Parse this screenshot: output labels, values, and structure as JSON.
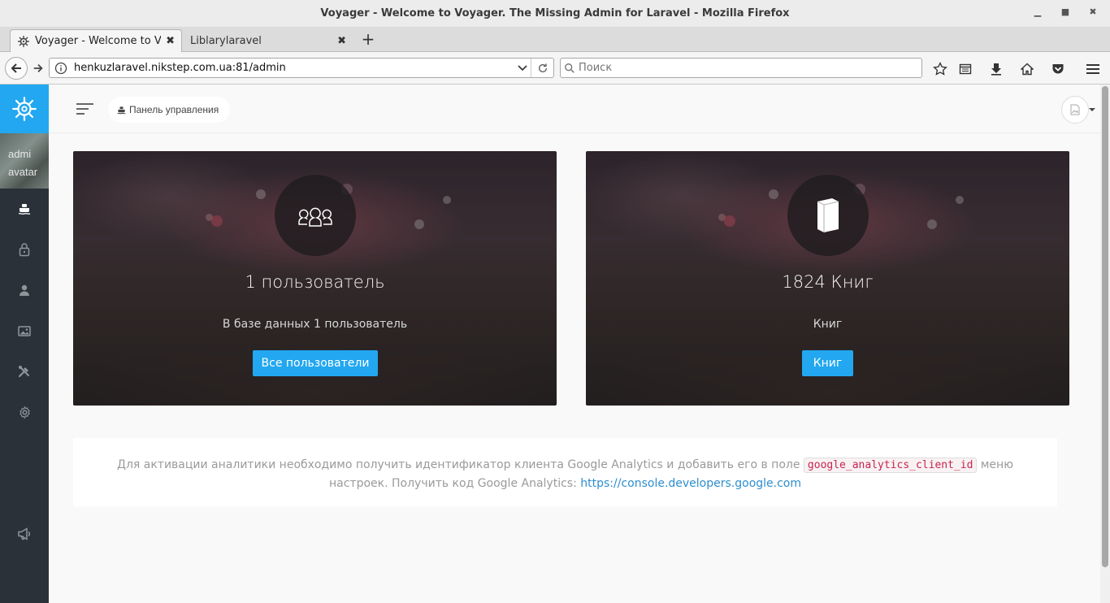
{
  "window": {
    "title": "Voyager - Welcome to Voyager. The Missing Admin for Laravel - Mozilla Firefox",
    "controls": [
      "minimize",
      "maximize",
      "close"
    ]
  },
  "tabs": [
    {
      "label": "Voyager - Welcome to Voyager. The Missing Admin for Laravel",
      "active": true
    },
    {
      "label": "Liblarylaravel",
      "active": false
    }
  ],
  "toolbar": {
    "url": "henkuzlaravel.nikstep.com.ua:81/admin",
    "search_placeholder": "Поиск"
  },
  "sidebar": {
    "avatar_text_line1": "admi",
    "avatar_text_line2": "avatar",
    "items": [
      {
        "icon": "boat-icon",
        "active": true
      },
      {
        "icon": "lock-icon"
      },
      {
        "icon": "person-icon"
      },
      {
        "icon": "images-icon"
      },
      {
        "icon": "tools-icon"
      },
      {
        "icon": "settings-icon"
      },
      {
        "icon": "megaphone-icon"
      }
    ]
  },
  "header": {
    "breadcrumb": "Панель управления"
  },
  "cards": [
    {
      "icon": "users-icon",
      "title": "1 пользователь",
      "description": "В базе данных 1 пользователь",
      "button": "Все пользователи"
    },
    {
      "icon": "book-icon",
      "title": "1824 Книг",
      "description": "Книг",
      "button": "Книг"
    }
  ],
  "analytics": {
    "text_before": "Для активации аналитики необходимо получить идентификатор клиента Google Analytics и добавить его в поле",
    "code": "google_analytics_client_id",
    "text_after": "меню настроек. Получить код Google Analytics:",
    "link": "https://console.developers.google.com"
  },
  "colors": {
    "accent": "#22a7f0",
    "sidebar": "#2a3139"
  }
}
